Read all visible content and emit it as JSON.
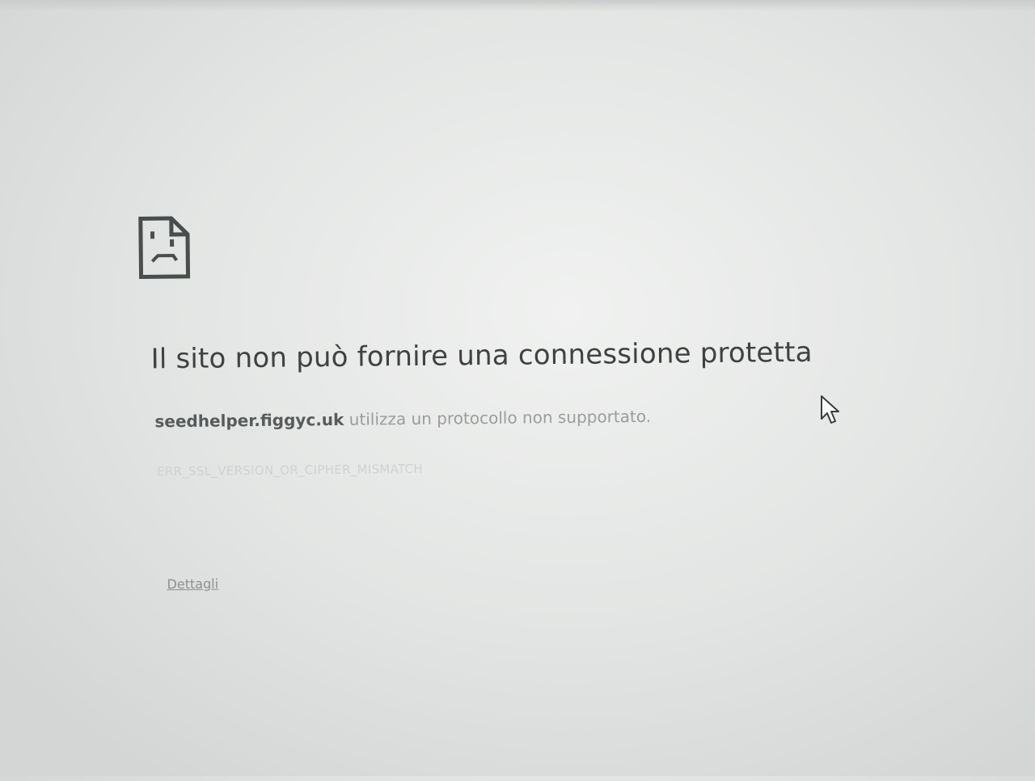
{
  "error": {
    "headline": "Il sito non può fornire una connessione protetta",
    "domain": "seedhelper.figgyc.uk",
    "message_suffix": " utilizza un protocollo non supportato.",
    "code": "ERR_SSL_VERSION_OR_CIPHER_MISMATCH",
    "details_label": "Dettagli",
    "icon": "sad-page-icon"
  },
  "cursor": {
    "icon": "mouse-pointer-icon"
  },
  "colors": {
    "background": "#e6e8e7",
    "headline": "#3f4242",
    "domain": "#585b5b",
    "message": "#9a9d9c",
    "code": "#cfd2d1",
    "link": "#8c908f"
  }
}
